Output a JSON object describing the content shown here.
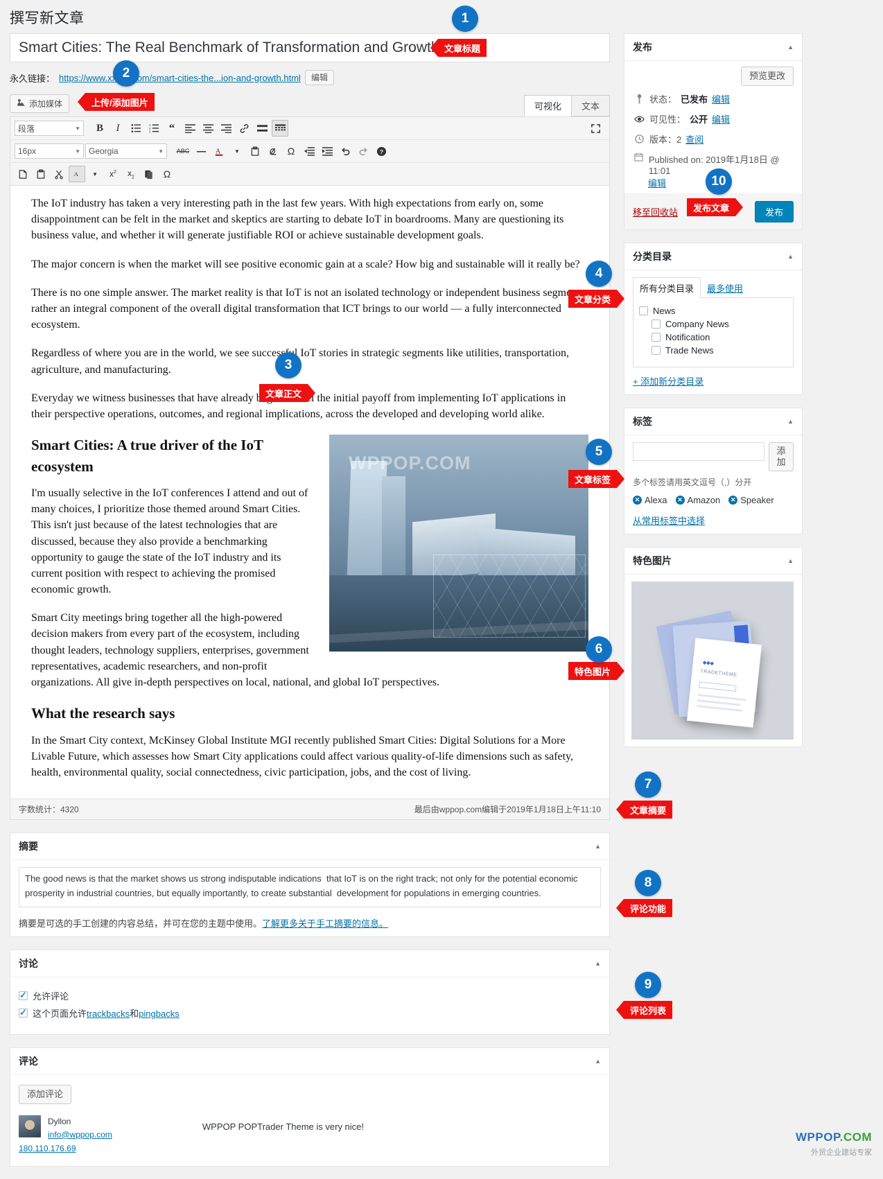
{
  "page": {
    "title": "撰写新文章"
  },
  "title_field": {
    "value": "Smart Cities: The Real Benchmark of Transformation and Growth"
  },
  "permalink": {
    "label": "永久链接：",
    "url": "https://www.xxxxx.com/smart-cities-the...ion-and-growth.html",
    "edit_button": "编辑"
  },
  "media": {
    "add_button": "添加媒体",
    "icon": "add-media-icon"
  },
  "editor_tabs": [
    {
      "label": "可视化",
      "active": true
    },
    {
      "label": "文本",
      "active": false
    }
  ],
  "toolbar": {
    "paragraph_select": "段落",
    "fontsize_select": "16px",
    "fontfamily_select": "Georgia",
    "buttons_row1": [
      "bold",
      "italic",
      "bullet-list",
      "numbered-list",
      "blockquote",
      "align-left",
      "align-center",
      "align-right",
      "link",
      "read-more",
      "kitchen-sink"
    ],
    "buttons_row2": [
      "strikethrough",
      "horizontal-rule",
      "text-color",
      "paste-as-text",
      "clear-formatting",
      "special-character",
      "outdent",
      "indent",
      "undo",
      "redo",
      "help"
    ],
    "buttons_row3": [
      "paste",
      "paste-word",
      "cut",
      "background-color",
      "superscript",
      "subscript",
      "copy",
      "omega"
    ],
    "fullscreen": "fullscreen-icon"
  },
  "post_body": {
    "paragraphs": [
      "The IoT industry has taken a very interesting path in the last few years. With high expectations from early on, some disappointment can be felt in the market and skeptics are starting to debate IoT in boardrooms. Many are questioning its business value, and whether it will generate justifiable ROI or achieve sustainable development goals.",
      "The major concern is when the market will see positive economic gain at a scale? How big and sustainable will it really be?",
      "There is no one simple answer. The market reality is that IoT is not an isolated technology or independent business segment, rather an integral component of the overall digital transformation that ICT brings to our world — a fully interconnected ecosystem.",
      "Regardless of where you are in the world, we see successful IoT stories in strategic segments like utilities, transportation, agriculture, and manufacturing.",
      "Everyday we witness businesses that have already begun to feel the initial payoff from implementing IoT applications in their perspective operations, outcomes, and regional implications, across the developed and developing world alike."
    ],
    "heading1": "Smart Cities: A true driver of the IoT ecosystem",
    "paragraphs2": [
      " I'm usually selective in the IoT conferences I attend and out of many choices, I prioritize those themed around Smart Cities. This isn't just because of the latest technologies that are discussed, because they also provide a benchmarking opportunity to gauge the state of the IoT industry and its current position with respect to achieving the promised economic growth.",
      "Smart City meetings bring together all the high-powered decision makers from every part of the ecosystem, including thought leaders, technology suppliers, enterprises, government representatives, academic researchers, and non-profit organizations. All give in-depth perspectives on local, national, and global IoT perspectives."
    ],
    "heading2": "What the research says",
    "paragraphs3": [
      "In the Smart City context, McKinsey Global Institute MGI recently published Smart Cities: Digital Solutions for a More Livable Future, which assesses how Smart City applications could affect various quality-of-life dimensions such as safety, health, environmental quality, social connectedness, civic participation, jobs, and the cost of living."
    ],
    "inline_image_watermark": "WPPOP.COM"
  },
  "wordcount": {
    "left": "字数统计：4320",
    "right": "最后由wppop.com编辑于2019年1月18日上午11:10"
  },
  "publish_box": {
    "title": "发布",
    "preview_button": "预览更改",
    "status_label": "状态：",
    "status_value": "已发布",
    "status_edit": "编辑",
    "visibility_label": "可见性：",
    "visibility_value": "公开",
    "visibility_edit": "编辑",
    "revision_label": "版本：2",
    "revision_link": "查阅",
    "published_on": "Published on: 2019年1月18日 @ 11:01",
    "published_edit": "编辑",
    "trash_link": "移至回收站",
    "publish_button": "发布"
  },
  "categories_box": {
    "title": "分类目录",
    "tab_all": "所有分类目录",
    "tab_most_used": "最多使用",
    "items": [
      {
        "label": "News",
        "child": false,
        "checked": false
      },
      {
        "label": "Company News",
        "child": true,
        "checked": false
      },
      {
        "label": "Notification",
        "child": true,
        "checked": false
      },
      {
        "label": "Trade News",
        "child": true,
        "checked": false
      }
    ],
    "add_new_link": "+ 添加新分类目录"
  },
  "tags_box": {
    "title": "标签",
    "input_value": "",
    "add_button": "添加",
    "hint": "多个标签请用英文逗号（,）分开",
    "tags": [
      "Alexa",
      "Amazon",
      "Speaker"
    ],
    "choose_link": "从常用标签中选择"
  },
  "featured_box": {
    "title": "特色图片",
    "thumb_brand": "TRADETHEME"
  },
  "excerpt_box": {
    "title": "摘要",
    "value": "The good news is that the market shows us strong indisputable indications  that IoT is on the right track; not only for the potential economic prosperity in industrial countries, but equally importantly, to create substantial  development for populations in emerging countries.",
    "note_text": "摘要是可选的手工创建的内容总结，并可在您的主题中使用。",
    "note_link": "了解更多关于手工摘要的信息。"
  },
  "discussion_box": {
    "title": "讨论",
    "allow_comments": "允许评论",
    "allow_comments_checked": true,
    "allow_pings_prefix": "这个页面允许",
    "allow_pings_link1": "trackbacks",
    "allow_pings_mid": "和",
    "allow_pings_link2": "pingbacks",
    "allow_pings_checked": true
  },
  "comments_box": {
    "title": "评论",
    "add_button": "添加评论",
    "comment": {
      "author": "Dyllon",
      "email": "info@wppop.com",
      "ip": "180.110.176.69",
      "text": "WPPOP POPTrader Theme is very nice!"
    }
  },
  "callouts": [
    {
      "num": "1",
      "tag": "文章标题"
    },
    {
      "num": "2",
      "tag": "上传/添加图片"
    },
    {
      "num": "3",
      "tag": "文章正文"
    },
    {
      "num": "4",
      "tag": "文章分类"
    },
    {
      "num": "5",
      "tag": "文章标签"
    },
    {
      "num": "6",
      "tag": "特色图片"
    },
    {
      "num": "7",
      "tag": "文章摘要"
    },
    {
      "num": "8",
      "tag": "评论功能"
    },
    {
      "num": "9",
      "tag": "评论列表"
    },
    {
      "num": "10",
      "tag": "发布文章"
    }
  ],
  "brand": {
    "name1": "WPPOP",
    "name2": ".COM",
    "sub": "外贸企业建站专家"
  },
  "colors": {
    "accent": "#0073aa",
    "callout_red": "#ee1111",
    "callout_blue": "#1273c4",
    "publish_blue": "#0085ba"
  }
}
